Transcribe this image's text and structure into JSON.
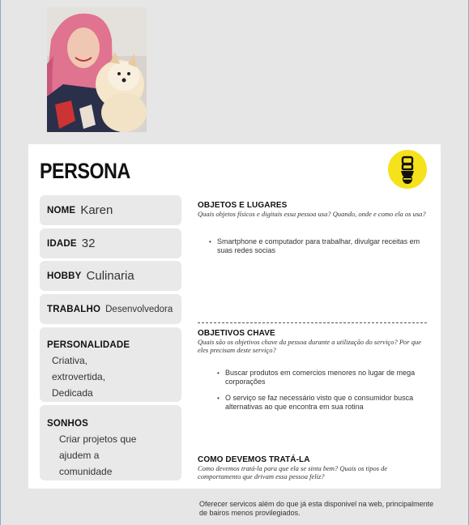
{
  "title": "PERSONA",
  "fields": {
    "nome": {
      "label": "NOME",
      "value": "Karen"
    },
    "idade": {
      "label": "IDADE",
      "value": "32"
    },
    "hobby": {
      "label": "HOBBY",
      "value": "Culinaria"
    },
    "trabalho": {
      "label": "TRABALHO",
      "value": "Desenvolvedora"
    },
    "personalidade": {
      "label": "PERSONALIDADE",
      "values": [
        "Criativa,",
        "extrovertida,",
        "Dedicada"
      ]
    },
    "sonhos": {
      "label": "SONHOS",
      "values": [
        "Criar projetos que",
        "ajudem a",
        "comunidade"
      ]
    }
  },
  "sections": [
    {
      "heading": "OBJETOS E LUGARES",
      "question": "Quais objetos físicos e digitais essa pessoa usa? Quando, onde e como ela os usa?",
      "items": [
        "Smartphone e computador para trabalhar, divulgar receitas em suas redes socias"
      ]
    },
    {
      "heading": "OBJETIVOS CHAVE",
      "question": "Quais são os objetivos chave da pessoa durante a utilização do serviço? Por que eles precisam deste serviço?",
      "items": [
        "Buscar produtos em comercios menores no lugar de mega corporações",
        "O serviço se faz necessário visto que o consumidor busca alternativas ao que encontra em sua rotina"
      ]
    },
    {
      "heading": "COMO DEVEMOS TRATÁ-LA",
      "question": "Como devemos tratá-la para que ela se sinta bem? Quais os tipos de comportamento que drivam essa pessoa feliz?",
      "items": []
    }
  ],
  "footer": "Oferecer servicos além do que já esta disponivel na web, principalmente de bairos menos provilegiados.",
  "colors": {
    "logo_yellow": "#f6e21a",
    "field_bg": "#e9e9e9",
    "page_bg": "#e6e6e6"
  },
  "icons": {
    "logo": "badge-logo-icon",
    "photo": "profile-photo"
  }
}
